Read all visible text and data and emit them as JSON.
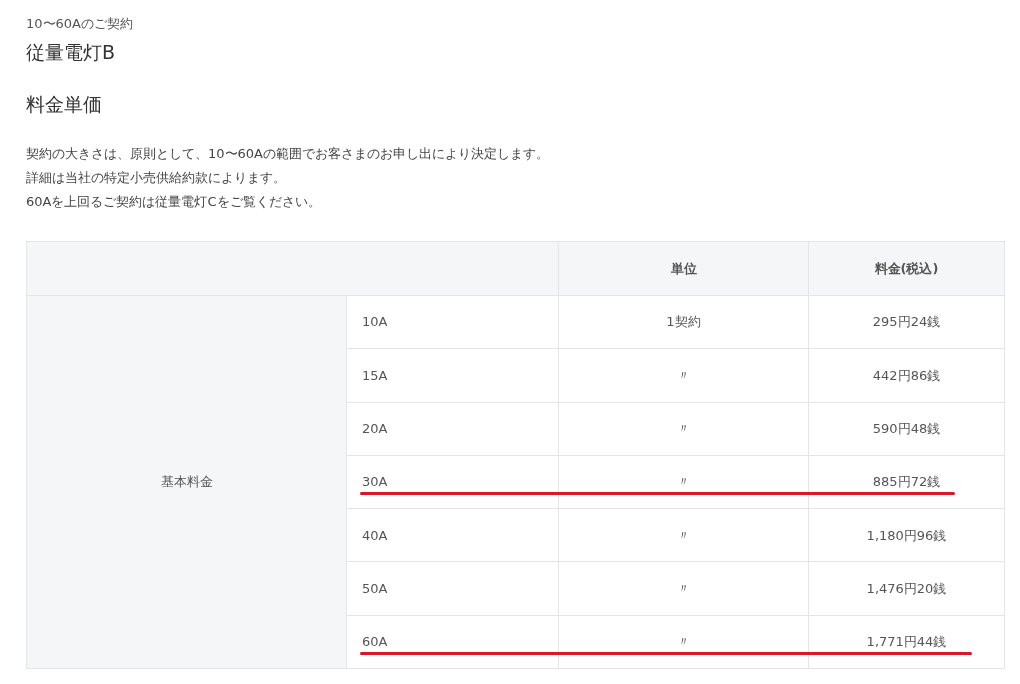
{
  "subtitle": "10〜60Aのご契約",
  "plan_title": "従量電灯B",
  "section_title": "料金単価",
  "description": [
    "契約の大きさは、原則として、10〜60Aの範囲でお客さまのお申し出により決定します。",
    "詳細は当社の特定小売供給約款によります。",
    "60Aを上回るご契約は従量電灯Cをご覧ください。"
  ],
  "table": {
    "columns": [
      "単位",
      "料金(税込)"
    ],
    "row_group": "基本料金",
    "rows": [
      {
        "capacity": "10A",
        "unit": "1契約",
        "price": "295円24銭",
        "underlined": false
      },
      {
        "capacity": "15A",
        "unit": "〃",
        "price": "442円86銭",
        "underlined": false
      },
      {
        "capacity": "20A",
        "unit": "〃",
        "price": "590円48銭",
        "underlined": false
      },
      {
        "capacity": "30A",
        "unit": "〃",
        "price": "885円72銭",
        "underlined": true
      },
      {
        "capacity": "40A",
        "unit": "〃",
        "price": "1,180円96銭",
        "underlined": false
      },
      {
        "capacity": "50A",
        "unit": "〃",
        "price": "1,476円20銭",
        "underlined": false
      },
      {
        "capacity": "60A",
        "unit": "〃",
        "price": "1,771円44銭",
        "underlined": true
      }
    ]
  }
}
